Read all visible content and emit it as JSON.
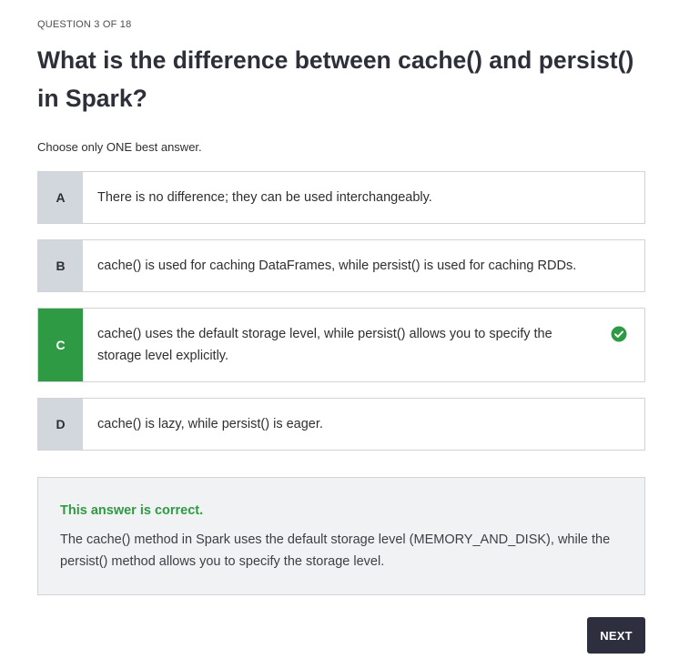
{
  "header": {
    "counter": "QUESTION 3 OF 18"
  },
  "question": {
    "text": "What is the difference between cache() and persist() in Spark?",
    "instruction": "Choose only ONE best answer."
  },
  "options": [
    {
      "letter": "A",
      "text": "There is no difference; they can be used interchangeably.",
      "selected": false
    },
    {
      "letter": "B",
      "text": "cache() is used for caching DataFrames, while persist() is used for caching RDDs.",
      "selected": false
    },
    {
      "letter": "C",
      "text": "cache() uses the default storage level, while persist() allows you to specify the storage level explicitly.",
      "selected": true,
      "icon": "check-circle-icon"
    },
    {
      "letter": "D",
      "text": "cache() is lazy, while persist() is eager.",
      "selected": false
    }
  ],
  "feedback": {
    "status": "This answer is correct.",
    "explanation": "The cache() method in Spark uses the default storage level (MEMORY_AND_DISK), while the persist() method allows you to specify the storage level."
  },
  "actions": {
    "next_label": "NEXT"
  },
  "colors": {
    "correct": "#2f9a44",
    "letter_bg": "#d1d7dc",
    "button_bg": "#2d2f3f",
    "feedback_bg": "#f1f2f3"
  }
}
